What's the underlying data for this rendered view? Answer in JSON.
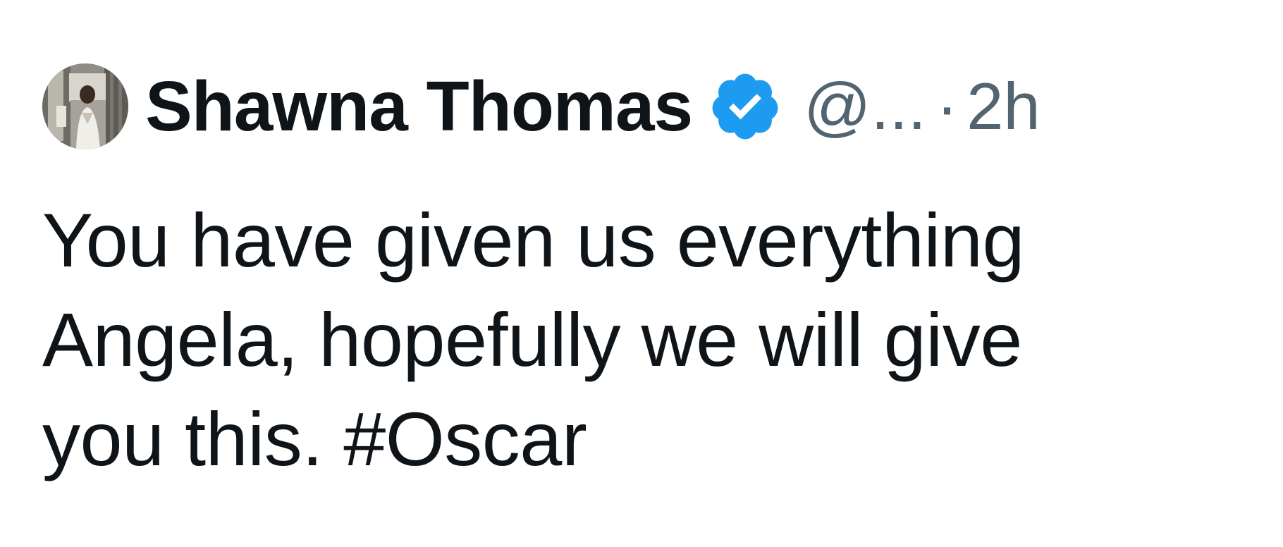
{
  "tweet": {
    "author": {
      "display_name": "Shawna Thomas",
      "handle": "@...",
      "verified": true,
      "avatar_icon": "profile-photo"
    },
    "separator": "·",
    "timestamp": "2h",
    "text_lines": [
      "You have given us everything",
      "Angela, hopefully we will give",
      "you this. #Oscar"
    ]
  },
  "colors": {
    "text_primary": "#0f1419",
    "text_secondary": "#536471",
    "verified_blue": "#1d9bf0",
    "background": "#ffffff"
  }
}
